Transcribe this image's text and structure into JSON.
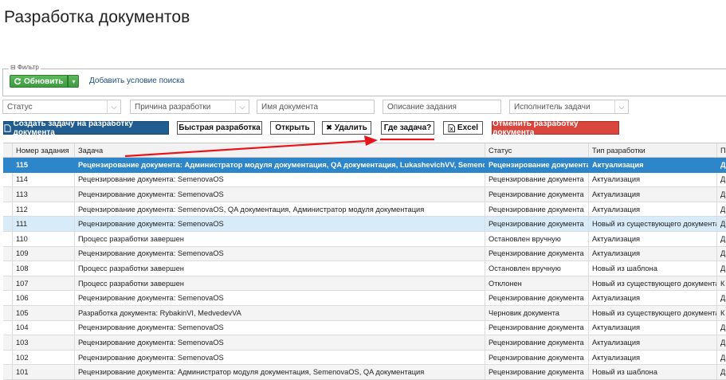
{
  "page": {
    "title": "Разработка документов"
  },
  "filter": {
    "legend": "⊟ Фильтр",
    "refresh_label": "Обновить",
    "add_condition_label": "Добавить условие поиска",
    "fields": {
      "status": "Статус",
      "reason": "Причина разработки",
      "doc_name": "Имя документа",
      "task_desc": "Описание задания",
      "executor": "Исполнитель задачи"
    }
  },
  "toolbar": {
    "create": "Создать задачу на разработку документа",
    "quick": "Быстрая разработка",
    "open": "Открыть",
    "delete": "Удалить",
    "where": "Где задача?",
    "excel": "Excel",
    "cancel": "Отменить разработку документа"
  },
  "colors": {
    "selected_row": "#2d86c9",
    "create_btn": "#215d91",
    "cancel_btn": "#d9463d",
    "refresh_btn": "#3e9b3e",
    "annotation": "#e8141c"
  },
  "table": {
    "columns": [
      "Номер задания",
      "Задача",
      "Статус",
      "Тип разработки",
      "П"
    ],
    "rows": [
      {
        "num": "115",
        "task": "Рецензирование документа: Администратор модуля документация, QA документация, LukashevichVV, SemenovaOS",
        "status": "Рецензирование документа",
        "type": "Актуализация",
        "extra": "Д"
      },
      {
        "num": "114",
        "task": "Рецензирование документа: SemenovaOS",
        "status": "Рецензирование документа",
        "type": "Актуализация",
        "extra": "Д"
      },
      {
        "num": "113",
        "task": "Рецензирование документа: SemenovaOS",
        "status": "Рецензирование документа",
        "type": "Актуализация",
        "extra": "Д"
      },
      {
        "num": "112",
        "task": "Рецензирование документа: SemenovaOS, QA документация, Администратор модуля документация",
        "status": "Рецензирование документа",
        "type": "Актуализация",
        "extra": "Д"
      },
      {
        "num": "111",
        "task": "Рецензирование документа: SemenovaOS",
        "status": "Рецензирование документа",
        "type": "Новый из существующего документа",
        "extra": "Д"
      },
      {
        "num": "110",
        "task": "Процесс разработки завершен",
        "status": "Остановлен вручную",
        "type": "Актуализация",
        "extra": "Д"
      },
      {
        "num": "109",
        "task": "Рецензирование документа: SemenovaOS",
        "status": "Рецензирование документа",
        "type": "Актуализация",
        "extra": "Д"
      },
      {
        "num": "108",
        "task": "Процесс разработки завершен",
        "status": "Остановлен вручную",
        "type": "Новый из шаблона",
        "extra": "Д"
      },
      {
        "num": "107",
        "task": "Процесс разработки завершен",
        "status": "Отклонен",
        "type": "Новый из существующего документа",
        "extra": "К"
      },
      {
        "num": "106",
        "task": "Рецензирование документа: SemenovaOS",
        "status": "Рецензирование документа",
        "type": "Актуализация",
        "extra": "Д"
      },
      {
        "num": "105",
        "task": "Разработка документа: RybakinVI, MedvedevVA",
        "status": "Черновик документа",
        "type": "Новый из существующего документа",
        "extra": "К"
      },
      {
        "num": "104",
        "task": "Рецензирование документа: SemenovaOS",
        "status": "Рецензирование документа",
        "type": "Актуализация",
        "extra": "Д"
      },
      {
        "num": "103",
        "task": "Рецензирование документа: SemenovaOS",
        "status": "Рецензирование документа",
        "type": "Актуализация",
        "extra": "Д"
      },
      {
        "num": "102",
        "task": "Рецензирование документа: SemenovaOS",
        "status": "Рецензирование документа",
        "type": "Актуализация",
        "extra": "Д"
      },
      {
        "num": "101",
        "task": "Рецензирование документа: Администратор модуля документация, SemenovaOS, QA документация",
        "status": "Рецензирование документа",
        "type": "Новый из шаблона",
        "extra": "Д"
      }
    ]
  }
}
